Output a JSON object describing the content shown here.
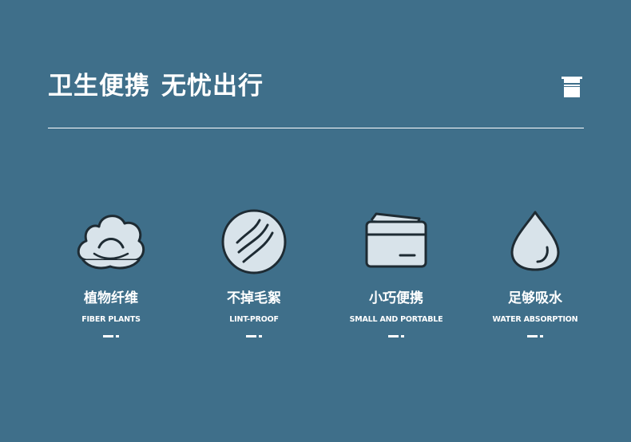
{
  "header": {
    "title_part1": "卫生便携",
    "title_part2": "无忧出行",
    "icon": "towel-icon"
  },
  "colors": {
    "background": "#3f6f8a",
    "icon_fill": "#d8e3ea",
    "icon_stroke": "#1e2b33",
    "text": "#ffffff"
  },
  "features": [
    {
      "cn": "植物纤维",
      "en": "FIBER PLANTS",
      "icon": "cotton-icon"
    },
    {
      "cn": "不掉毛絮",
      "en": "LINT-PROOF",
      "icon": "wavy-circle-icon"
    },
    {
      "cn": "小巧便携",
      "en": "SMALL AND PORTABLE",
      "icon": "card-icon"
    },
    {
      "cn": "足够吸水",
      "en": "WATER ABSORPTION",
      "icon": "water-drop-icon"
    }
  ]
}
